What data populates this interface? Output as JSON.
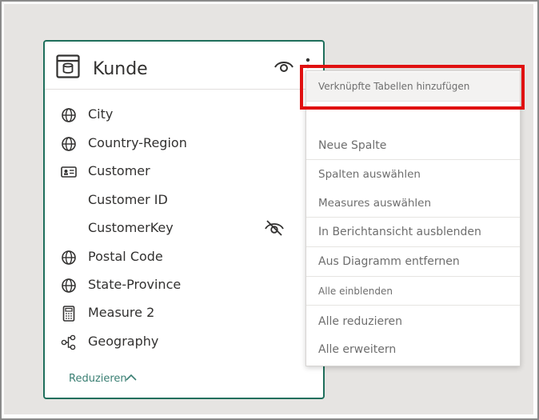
{
  "table": {
    "title": "Kunde",
    "icon": "table-icon",
    "fields": [
      {
        "label": "City",
        "icon": "globe-icon"
      },
      {
        "label": "Country-Region",
        "icon": "globe-icon"
      },
      {
        "label": "Customer",
        "icon": "id-card-icon"
      },
      {
        "label": "Customer ID",
        "icon": ""
      },
      {
        "label": "CustomerKey",
        "icon": "",
        "hidden": true
      },
      {
        "label": "Postal Code",
        "icon": "globe-icon"
      },
      {
        "label": "State-Province",
        "icon": "globe-icon"
      },
      {
        "label": "Measure 2",
        "icon": "calculator-icon"
      },
      {
        "label": "Geography",
        "icon": "hierarchy-icon"
      }
    ],
    "collapse_label": "Reduzieren"
  },
  "context_menu": {
    "items": [
      {
        "label": "Verknüpfte Tabellen hinzufügen"
      },
      {
        "label": "Neue Spalte"
      },
      {
        "label": "Spalten auswählen"
      },
      {
        "label": "Measures auswählen"
      },
      {
        "label": "In Berichtansicht ausblenden"
      },
      {
        "label": "Aus Diagramm entfernen"
      },
      {
        "label": "Alle einblenden"
      },
      {
        "label": "Alle reduzieren"
      },
      {
        "label": "Alle erweitern"
      }
    ]
  },
  "colors": {
    "card_border": "#1f6f5c",
    "highlight_border": "#e01010",
    "link": "#3a7f73"
  }
}
